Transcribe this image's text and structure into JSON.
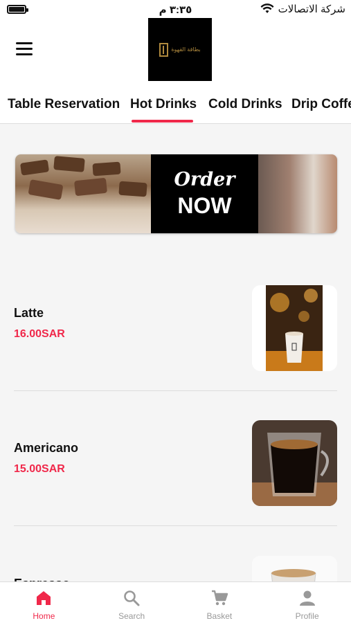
{
  "status_bar": {
    "time": "٣:٣٥ م",
    "carrier": "شركة الاتصالات"
  },
  "header": {
    "logo_text": "بطاقة القهوة"
  },
  "tabs": [
    {
      "label": "Table Reservation"
    },
    {
      "label": "Hot Drinks"
    },
    {
      "label": "Cold Drinks"
    },
    {
      "label": "Drip Coffee"
    }
  ],
  "active_tab": "Hot Drinks",
  "banner": {
    "line1": "Order",
    "line2": "NOW"
  },
  "products": [
    {
      "name": "Latte",
      "price": "16.00SAR"
    },
    {
      "name": "Americano",
      "price": "15.00SAR"
    },
    {
      "name": "Espresso",
      "price": ""
    }
  ],
  "bottom_nav": [
    {
      "label": "Home",
      "icon": "home-icon"
    },
    {
      "label": "Search",
      "icon": "search-icon"
    },
    {
      "label": "Basket",
      "icon": "cart-icon"
    },
    {
      "label": "Profile",
      "icon": "profile-icon"
    }
  ],
  "colors": {
    "accent": "#f0284a",
    "inactive": "#999999"
  }
}
